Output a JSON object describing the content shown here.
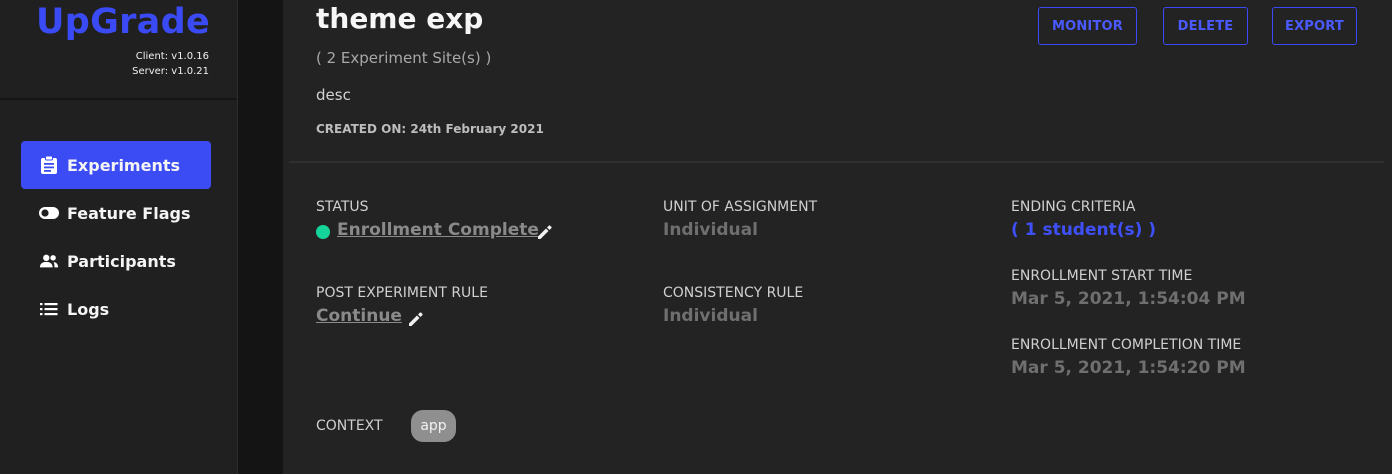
{
  "app": {
    "logo": "UpGrade",
    "client_version": "Client: v1.0.16",
    "server_version": "Server: v1.0.21",
    "colors": {
      "accent": "#3b4cf5",
      "status_green": "#15d49a"
    }
  },
  "sidebar": {
    "items": [
      {
        "label": "Experiments",
        "icon": "clipboard-icon",
        "active": true
      },
      {
        "label": "Feature Flags",
        "icon": "toggle-icon"
      },
      {
        "label": "Participants",
        "icon": "people-icon"
      },
      {
        "label": "Logs",
        "icon": "list-icon"
      }
    ]
  },
  "experiment": {
    "title": "theme exp",
    "sites": "( 2 Experiment Site(s) )",
    "description": "desc",
    "created_on": "CREATED ON: 24th February 2021"
  },
  "actions": {
    "monitor": "MONITOR",
    "delete": "DELETE",
    "export": "EXPORT"
  },
  "details": {
    "status_label": "STATUS",
    "status_value": "Enrollment Complete",
    "unit_label": "UNIT OF ASSIGNMENT",
    "unit_value": "Individual",
    "ending_label": "ENDING CRITERIA",
    "ending_open": "( ",
    "ending_value": "1 student(s)",
    "ending_close": " )",
    "post_rule_label": "POST EXPERIMENT RULE",
    "post_rule_value": "Continue",
    "consistency_label": "CONSISTENCY RULE",
    "consistency_value": "Individual",
    "start_label": "ENROLLMENT START TIME",
    "start_value": "Mar 5, 2021, 1:54:04 PM",
    "completion_label": "ENROLLMENT COMPLETION TIME",
    "completion_value": "Mar 5, 2021, 1:54:20 PM",
    "context_label": "CONTEXT",
    "context_chip": "app"
  }
}
